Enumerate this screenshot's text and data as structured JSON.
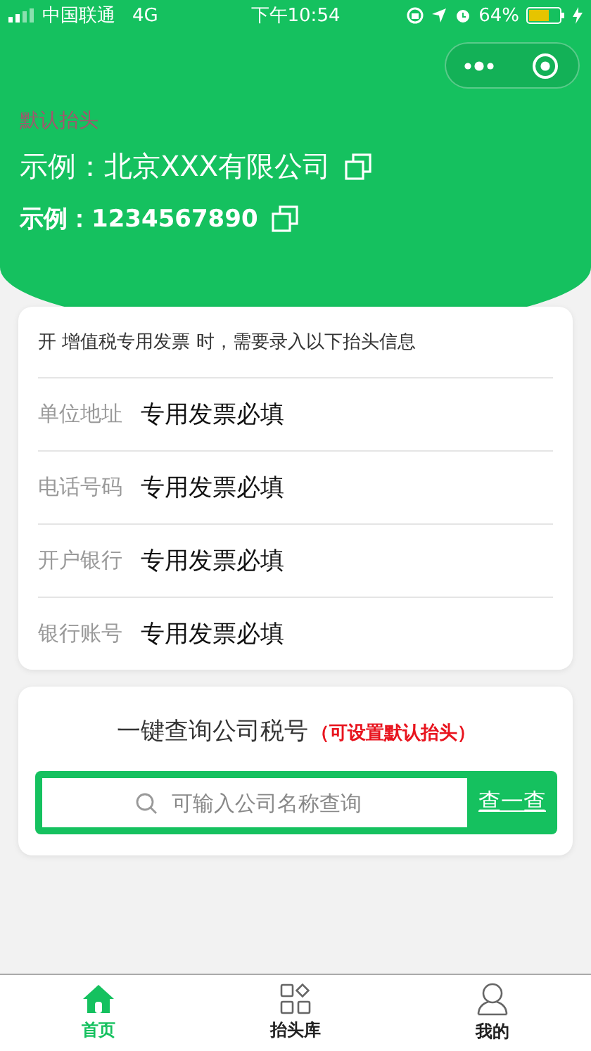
{
  "status_bar": {
    "carrier": "中国联通",
    "network": "4G",
    "time": "下午10:54",
    "battery": "64%"
  },
  "header": {
    "label": "默认抬头",
    "company": "示例：北京XXX有限公司",
    "tax_number": "示例：1234567890"
  },
  "info_card": {
    "notice": "开 增值税专用发票 时，需要录入以下抬头信息",
    "fields": [
      {
        "label": "单位地址",
        "value": "专用发票必填"
      },
      {
        "label": "电话号码",
        "value": "专用发票必填"
      },
      {
        "label": "开户银行",
        "value": "专用发票必填"
      },
      {
        "label": "银行账号",
        "value": "专用发票必填"
      }
    ]
  },
  "query_card": {
    "title": "一键查询公司税号",
    "note": "（可设置默认抬头）",
    "search": {
      "placeholder": "可输入公司名称查询"
    },
    "button": "查一查"
  },
  "tab_bar": [
    {
      "label": "首页",
      "kind": "home",
      "selected": true
    },
    {
      "label": "抬头库",
      "kind": "library",
      "selected": false
    },
    {
      "label": "我的",
      "kind": "profile",
      "selected": false
    }
  ]
}
